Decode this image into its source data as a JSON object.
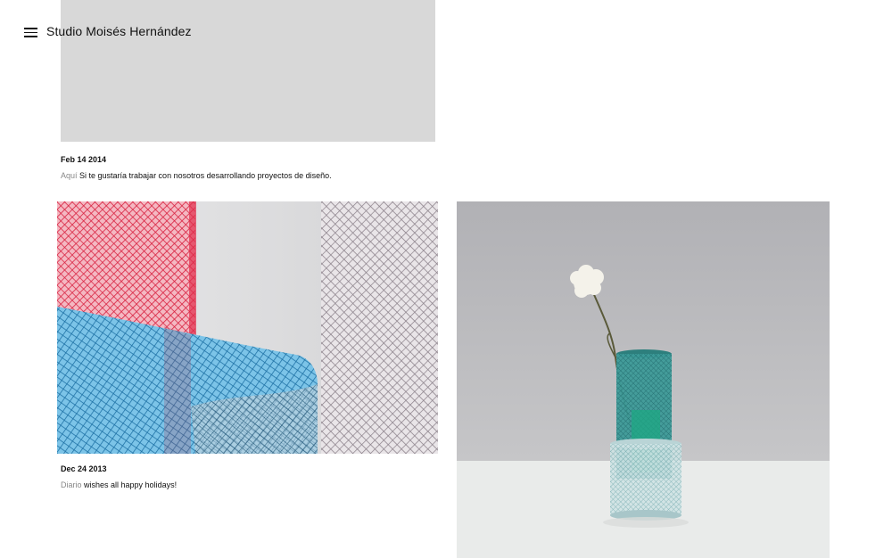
{
  "site": {
    "title": "Studio Moisés Hernández"
  },
  "posts": [
    {
      "date": "Feb 14 2014",
      "category": "Aquí",
      "text": " Si te gustaría trabajar con nosotros desarrollando proyectos de diseño."
    },
    {
      "date": "Dec 24 2013",
      "category": "Diario",
      "text": " wishes all happy holidays!"
    }
  ],
  "colors": {
    "placeholder": "#d8d8d8",
    "category_text": "#888888",
    "mesh_red": "#e23a55",
    "mesh_blue": "#2f93c9",
    "mesh_grey": "#8e8890",
    "vase_green": "#2a8f8a",
    "backdrop": "#b2b2b4"
  },
  "icons": {
    "menu": "hamburger-menu-icon"
  }
}
